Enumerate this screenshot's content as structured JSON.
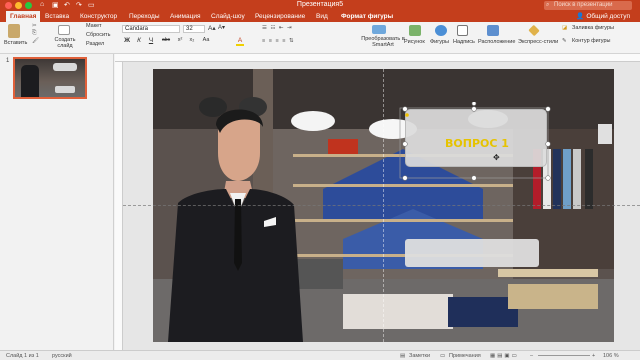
{
  "window": {
    "title": "Презентация5",
    "search_placeholder": "Поиск в презентации"
  },
  "tabs": [
    {
      "label": "Главная",
      "active": true
    },
    {
      "label": "Вставка"
    },
    {
      "label": "Конструктор"
    },
    {
      "label": "Переходы"
    },
    {
      "label": "Анимация"
    },
    {
      "label": "Слайд-шоу"
    },
    {
      "label": "Рецензирование"
    },
    {
      "label": "Вид"
    },
    {
      "label": "Формат фигуры"
    }
  ],
  "share_label": "Общий доступ",
  "ribbon": {
    "paste": "Вставить",
    "new_slide": "Создать слайд",
    "layout": "Макет",
    "reset": "Сбросить",
    "section": "Раздел",
    "font_name": "Candara",
    "font_size": "32",
    "convert_smartart": "Преобразовать в SmartArt",
    "picture": "Рисунок",
    "shapes": "Фигуры",
    "textbox": "Надпись",
    "arrange": "Расположение",
    "quick_styles": "Экспресс-стили",
    "shape_fill": "Заливка фигуры",
    "shape_outline": "Контур фигуры",
    "format_buttons": [
      "Ж",
      "К",
      "Ч",
      "abc",
      "x²",
      "x₂",
      "Аа",
      "A"
    ]
  },
  "thumbnail": {
    "number": "1"
  },
  "slide": {
    "question_text": "ВОПРОС 1"
  },
  "status": {
    "slide_counter": "Слайд 1 из 1",
    "language": "русский",
    "notes": "Заметки",
    "comments": "Примечания",
    "zoom": "106 %"
  },
  "colors": {
    "accent": "#c43e1c",
    "question_text": "#e6c300"
  }
}
